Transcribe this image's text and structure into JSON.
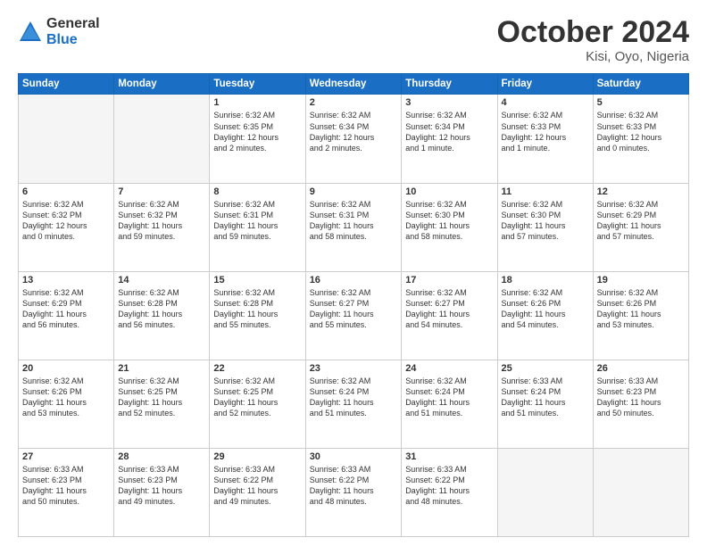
{
  "header": {
    "logo_general": "General",
    "logo_blue": "Blue",
    "month_title": "October 2024",
    "location": "Kisi, Oyo, Nigeria"
  },
  "weekdays": [
    "Sunday",
    "Monday",
    "Tuesday",
    "Wednesday",
    "Thursday",
    "Friday",
    "Saturday"
  ],
  "weeks": [
    [
      {
        "day": "",
        "info": ""
      },
      {
        "day": "",
        "info": ""
      },
      {
        "day": "1",
        "info": "Sunrise: 6:32 AM\nSunset: 6:35 PM\nDaylight: 12 hours\nand 2 minutes."
      },
      {
        "day": "2",
        "info": "Sunrise: 6:32 AM\nSunset: 6:34 PM\nDaylight: 12 hours\nand 2 minutes."
      },
      {
        "day": "3",
        "info": "Sunrise: 6:32 AM\nSunset: 6:34 PM\nDaylight: 12 hours\nand 1 minute."
      },
      {
        "day": "4",
        "info": "Sunrise: 6:32 AM\nSunset: 6:33 PM\nDaylight: 12 hours\nand 1 minute."
      },
      {
        "day": "5",
        "info": "Sunrise: 6:32 AM\nSunset: 6:33 PM\nDaylight: 12 hours\nand 0 minutes."
      }
    ],
    [
      {
        "day": "6",
        "info": "Sunrise: 6:32 AM\nSunset: 6:32 PM\nDaylight: 12 hours\nand 0 minutes."
      },
      {
        "day": "7",
        "info": "Sunrise: 6:32 AM\nSunset: 6:32 PM\nDaylight: 11 hours\nand 59 minutes."
      },
      {
        "day": "8",
        "info": "Sunrise: 6:32 AM\nSunset: 6:31 PM\nDaylight: 11 hours\nand 59 minutes."
      },
      {
        "day": "9",
        "info": "Sunrise: 6:32 AM\nSunset: 6:31 PM\nDaylight: 11 hours\nand 58 minutes."
      },
      {
        "day": "10",
        "info": "Sunrise: 6:32 AM\nSunset: 6:30 PM\nDaylight: 11 hours\nand 58 minutes."
      },
      {
        "day": "11",
        "info": "Sunrise: 6:32 AM\nSunset: 6:30 PM\nDaylight: 11 hours\nand 57 minutes."
      },
      {
        "day": "12",
        "info": "Sunrise: 6:32 AM\nSunset: 6:29 PM\nDaylight: 11 hours\nand 57 minutes."
      }
    ],
    [
      {
        "day": "13",
        "info": "Sunrise: 6:32 AM\nSunset: 6:29 PM\nDaylight: 11 hours\nand 56 minutes."
      },
      {
        "day": "14",
        "info": "Sunrise: 6:32 AM\nSunset: 6:28 PM\nDaylight: 11 hours\nand 56 minutes."
      },
      {
        "day": "15",
        "info": "Sunrise: 6:32 AM\nSunset: 6:28 PM\nDaylight: 11 hours\nand 55 minutes."
      },
      {
        "day": "16",
        "info": "Sunrise: 6:32 AM\nSunset: 6:27 PM\nDaylight: 11 hours\nand 55 minutes."
      },
      {
        "day": "17",
        "info": "Sunrise: 6:32 AM\nSunset: 6:27 PM\nDaylight: 11 hours\nand 54 minutes."
      },
      {
        "day": "18",
        "info": "Sunrise: 6:32 AM\nSunset: 6:26 PM\nDaylight: 11 hours\nand 54 minutes."
      },
      {
        "day": "19",
        "info": "Sunrise: 6:32 AM\nSunset: 6:26 PM\nDaylight: 11 hours\nand 53 minutes."
      }
    ],
    [
      {
        "day": "20",
        "info": "Sunrise: 6:32 AM\nSunset: 6:26 PM\nDaylight: 11 hours\nand 53 minutes."
      },
      {
        "day": "21",
        "info": "Sunrise: 6:32 AM\nSunset: 6:25 PM\nDaylight: 11 hours\nand 52 minutes."
      },
      {
        "day": "22",
        "info": "Sunrise: 6:32 AM\nSunset: 6:25 PM\nDaylight: 11 hours\nand 52 minutes."
      },
      {
        "day": "23",
        "info": "Sunrise: 6:32 AM\nSunset: 6:24 PM\nDaylight: 11 hours\nand 51 minutes."
      },
      {
        "day": "24",
        "info": "Sunrise: 6:32 AM\nSunset: 6:24 PM\nDaylight: 11 hours\nand 51 minutes."
      },
      {
        "day": "25",
        "info": "Sunrise: 6:33 AM\nSunset: 6:24 PM\nDaylight: 11 hours\nand 51 minutes."
      },
      {
        "day": "26",
        "info": "Sunrise: 6:33 AM\nSunset: 6:23 PM\nDaylight: 11 hours\nand 50 minutes."
      }
    ],
    [
      {
        "day": "27",
        "info": "Sunrise: 6:33 AM\nSunset: 6:23 PM\nDaylight: 11 hours\nand 50 minutes."
      },
      {
        "day": "28",
        "info": "Sunrise: 6:33 AM\nSunset: 6:23 PM\nDaylight: 11 hours\nand 49 minutes."
      },
      {
        "day": "29",
        "info": "Sunrise: 6:33 AM\nSunset: 6:22 PM\nDaylight: 11 hours\nand 49 minutes."
      },
      {
        "day": "30",
        "info": "Sunrise: 6:33 AM\nSunset: 6:22 PM\nDaylight: 11 hours\nand 48 minutes."
      },
      {
        "day": "31",
        "info": "Sunrise: 6:33 AM\nSunset: 6:22 PM\nDaylight: 11 hours\nand 48 minutes."
      },
      {
        "day": "",
        "info": ""
      },
      {
        "day": "",
        "info": ""
      }
    ]
  ]
}
